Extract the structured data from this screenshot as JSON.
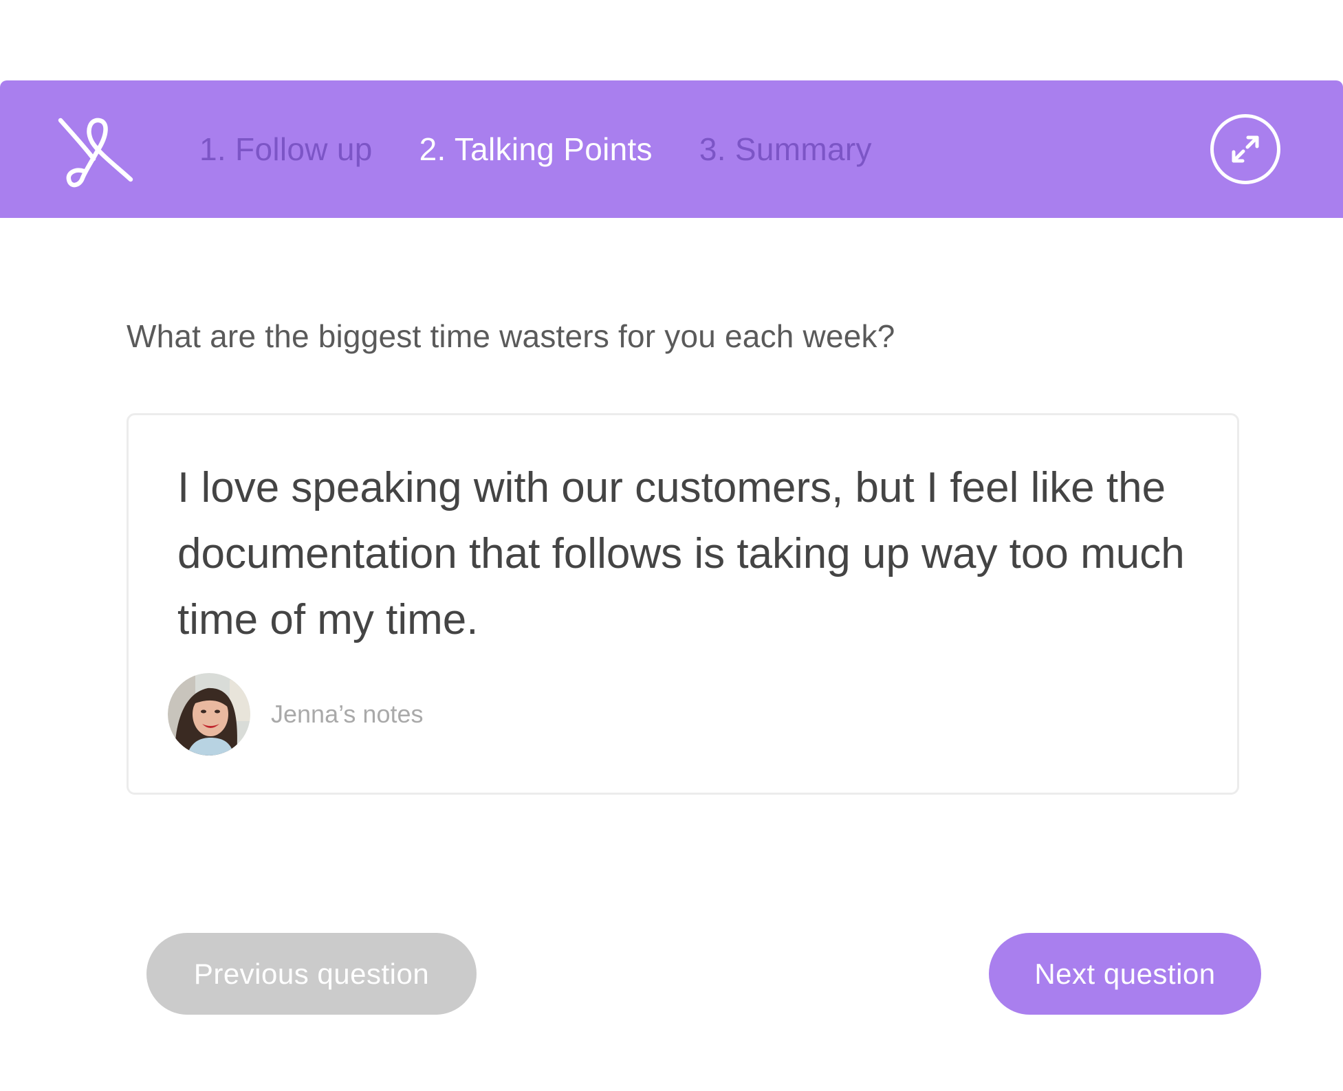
{
  "colors": {
    "brand": "#a97fee",
    "tab_inactive": "#7c55c6",
    "tab_active": "#ffffff",
    "text_primary": "#444444",
    "disabled_button": "#cbcbcb"
  },
  "header": {
    "logo_icon": "knot-logo-icon",
    "tabs": [
      {
        "label": "1. Follow up",
        "active": false
      },
      {
        "label": "2. Talking Points",
        "active": true
      },
      {
        "label": "3. Summary",
        "active": false
      }
    ],
    "expand_icon": "expand-arrows-icon"
  },
  "main": {
    "question": "What are the biggest time wasters for you each week?",
    "answer": {
      "text": "I love speaking with our customers, but I feel like the documentation that follows is taking up way too much time of my time.",
      "author_label": "Jenna’s notes",
      "avatar_icon": "avatar-photo"
    }
  },
  "footer": {
    "previous_label": "Previous question",
    "previous_disabled": true,
    "next_label": "Next question"
  }
}
